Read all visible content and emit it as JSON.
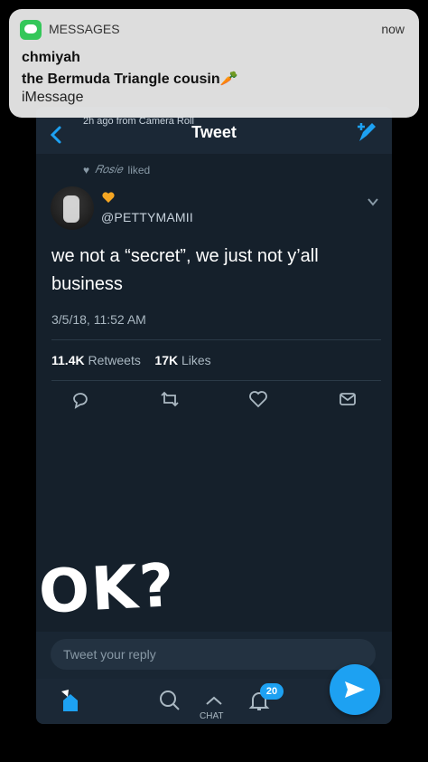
{
  "notification": {
    "app_name": "MESSAGES",
    "time": "now",
    "sender": "chmiyah",
    "body": "the Bermuda Triangle cousin🥕",
    "subtitle": "iMessage"
  },
  "topbar": {
    "source": "2h ago from Camera Roll",
    "title": "Tweet"
  },
  "tweet": {
    "liked_by": "𝑅𝑜𝑠𝑖𝑒",
    "liked_label": "liked",
    "handle": "@PETTYMAMII",
    "text": "we not a “secret”, we just not y’all business",
    "timestamp": "3/5/18, 11:52 AM",
    "retweets_count": "11.4K",
    "retweets_label": "Retweets",
    "likes_count": "17K",
    "likes_label": "Likes"
  },
  "overlay_text": "OK?",
  "reply": {
    "placeholder": "Tweet your reply"
  },
  "tabbar": {
    "chat_label": "CHAT",
    "notif_count": "20"
  },
  "colors": {
    "background": "#15202b",
    "accent": "#1da1f2",
    "message_green": "#34c759"
  },
  "icons": [
    "messages-app-icon",
    "back-arrow-icon",
    "compose-tweet-icon",
    "heart-icon",
    "chevron-down-icon",
    "reply-icon",
    "retweet-icon",
    "like-icon",
    "share-icon",
    "home-icon",
    "search-icon",
    "chat-icon",
    "notifications-icon",
    "send-icon"
  ]
}
